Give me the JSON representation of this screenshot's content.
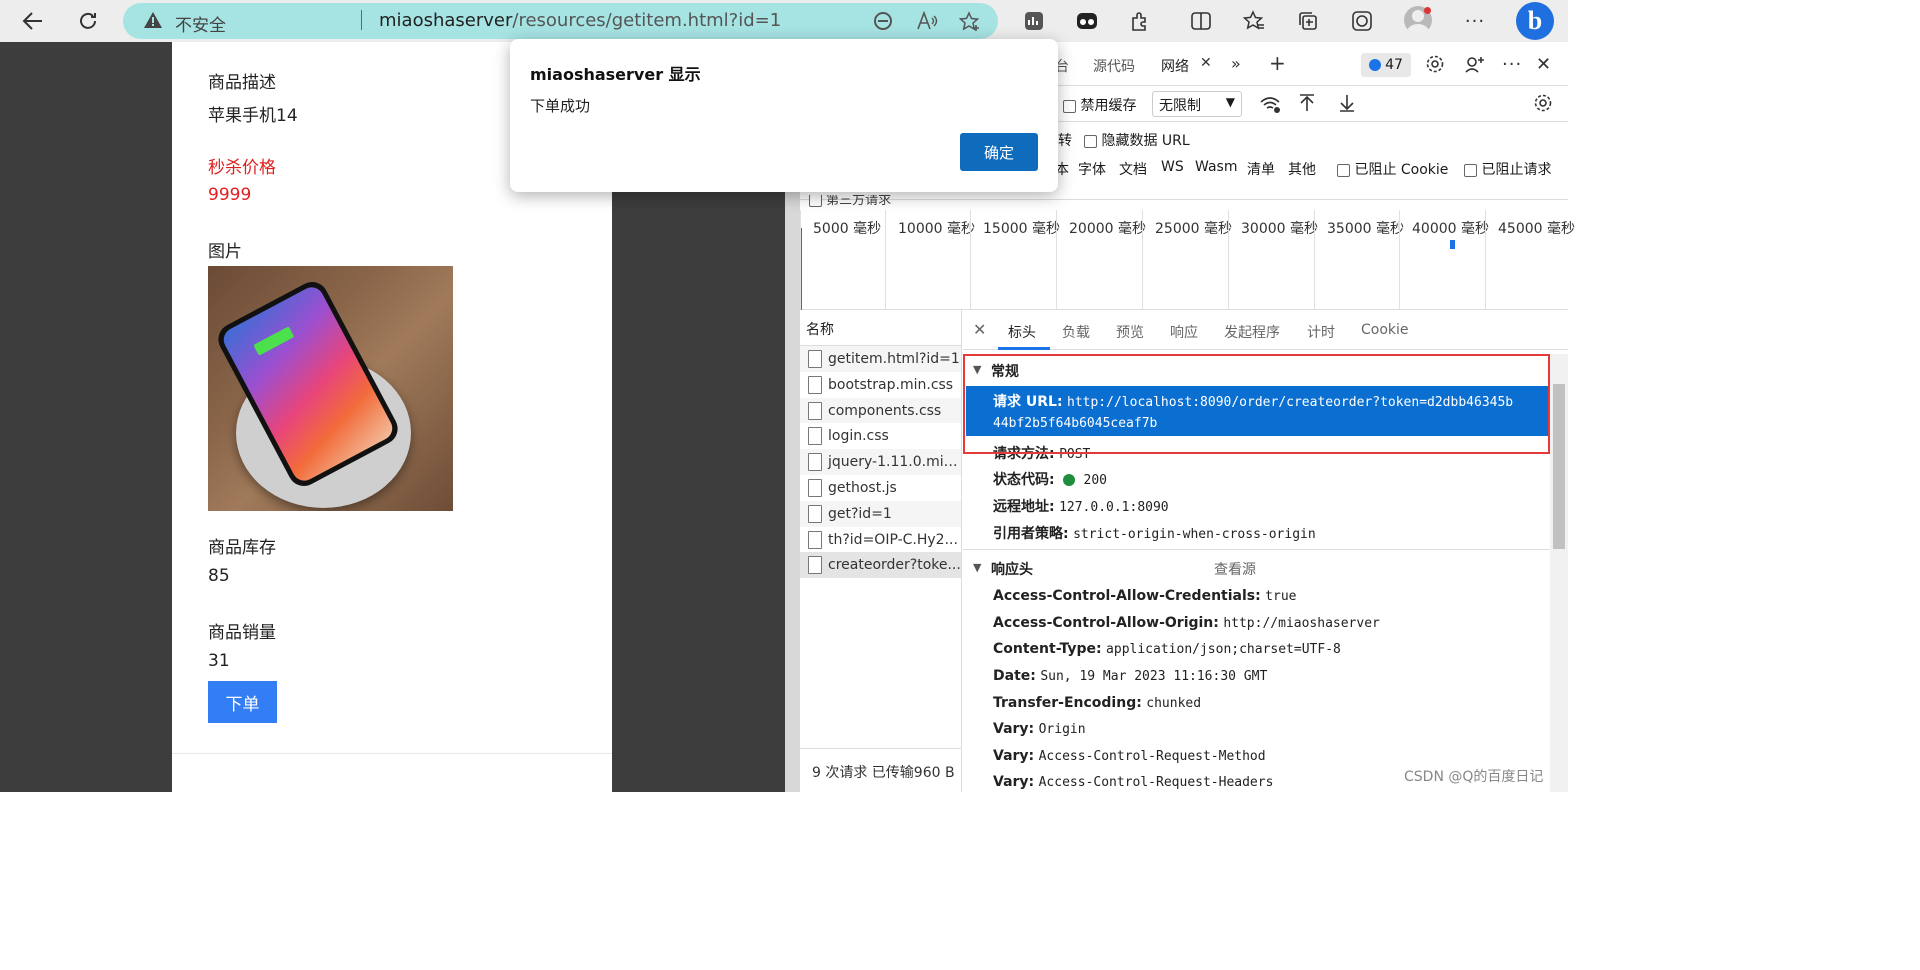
{
  "browser": {
    "address": {
      "insecure_label": "不安全",
      "host": "miaoshaserver",
      "path": "/resources/getitem.html?id=1"
    },
    "icons": [
      "back-icon",
      "refresh-icon",
      "warning-icon",
      "read-aloud-icon",
      "favorite-add-icon",
      "extensions-icon",
      "split-screen-icon",
      "favorites-icon",
      "collections-icon",
      "profile-icon",
      "more-icon",
      "bing-icon"
    ]
  },
  "page": {
    "desc_label": "商品描述",
    "desc_value": "苹果手机14",
    "price_label": "秒杀价格",
    "price_value": "9999",
    "image_label": "图片",
    "stock_label": "商品库存",
    "stock_value": "85",
    "sales_label": "商品销量",
    "sales_value": "31",
    "order_button": "下单"
  },
  "dialog": {
    "title": "miaoshaserver 显示",
    "message": "下单成功",
    "ok_label": "确定"
  },
  "devtools": {
    "tabs": [
      "台",
      "源代码",
      "网络"
    ],
    "issues_count": "47",
    "disable_cache": "禁用缓存",
    "throttle": "无限制",
    "row3_partial": "转",
    "hide_data_urls": "隐藏数据 URL",
    "filter_partial": "本",
    "filters": [
      "字体",
      "文档",
      "WS",
      "Wasm",
      "清单",
      "其他"
    ],
    "blocked_cookies": "已阻止 Cookie",
    "blocked_requests": "已阻止请求",
    "third_party": "第三方请求",
    "timeline_ticks": [
      "5000 毫秒",
      "10000 毫秒",
      "15000 毫秒",
      "20000 毫秒",
      "25000 毫秒",
      "30000 毫秒",
      "35000 毫秒",
      "40000 毫秒",
      "45000 毫秒"
    ],
    "name_header": "名称",
    "requests": [
      "getitem.html?id=1",
      "bootstrap.min.css",
      "components.css",
      "login.css",
      "jquery-1.11.0.min.js",
      "gethost.js",
      "get?id=1",
      "th?id=OIP-C.Hy2...",
      "createorder?toke..."
    ],
    "footer": "9 次请求   已传输960 B",
    "detail_tabs": [
      "标头",
      "负载",
      "预览",
      "响应",
      "发起程序",
      "计时",
      "Cookie"
    ],
    "general": {
      "section": "常规",
      "url_key": "请求 URL:",
      "url_line1": "http://localhost:8090/order/createorder?token=d2dbb46345b",
      "url_line2": "44bf2b5f64b6045ceaf7b",
      "method_key": "请求方法:",
      "method_val": "POST",
      "status_key": "状态代码:",
      "status_val": "200",
      "remote_key": "远程地址:",
      "remote_val": "127.0.0.1:8090",
      "referrer_key": "引用者策略:",
      "referrer_val": "strict-origin-when-cross-origin"
    },
    "response": {
      "section": "响应头",
      "view_source": "查看源",
      "headers": [
        {
          "k": "Access-Control-Allow-Credentials:",
          "v": "true"
        },
        {
          "k": "Access-Control-Allow-Origin:",
          "v": "http://miaoshaserver"
        },
        {
          "k": "Content-Type:",
          "v": "application/json;charset=UTF-8"
        },
        {
          "k": "Date:",
          "v": "Sun, 19 Mar 2023 11:16:30 GMT"
        },
        {
          "k": "Transfer-Encoding:",
          "v": "chunked"
        },
        {
          "k": "Vary:",
          "v": "Origin"
        },
        {
          "k": "Vary:",
          "v": "Access-Control-Request-Method"
        },
        {
          "k": "Vary:",
          "v": "Access-Control-Request-Headers"
        }
      ]
    }
  },
  "watermark": "CSDN @Q的百度日记"
}
